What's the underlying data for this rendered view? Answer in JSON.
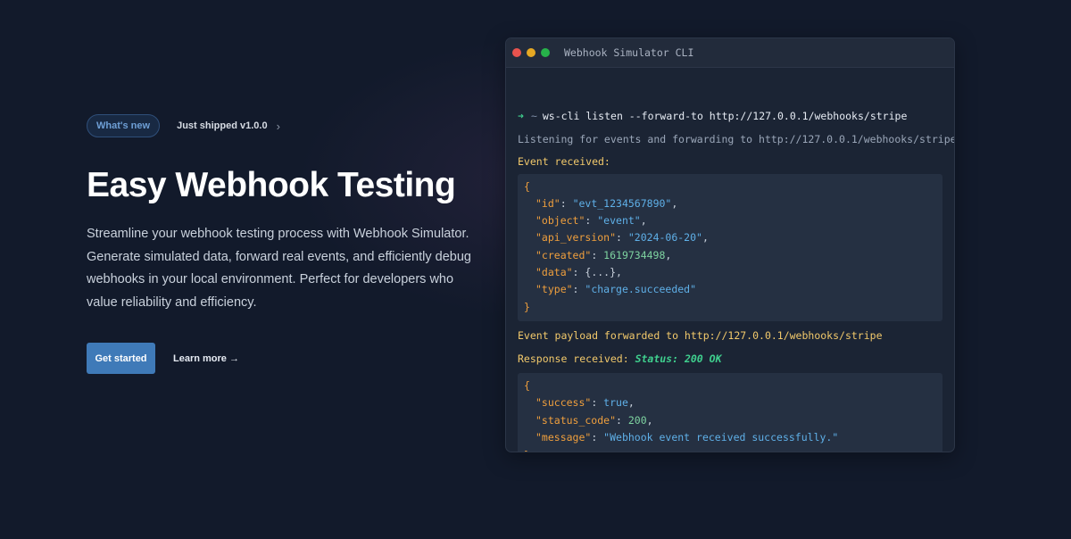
{
  "hero": {
    "badge": "What's new",
    "shipped": "Just shipped v1.0.0",
    "title": "Easy Webhook Testing",
    "description": "Streamline your webhook testing process with Webhook Simulator. Generate simulated data, forward real events, and efficiently debug webhooks in your local environment. Perfect for developers who value reliability and efficiency.",
    "cta_primary": "Get started",
    "cta_secondary": "Learn more →"
  },
  "terminal": {
    "title": "Webhook Simulator CLI",
    "prompt_symbol": "➜",
    "prompt_dir": "~",
    "command": "ws-cli listen --forward-to http://127.0.0.1/webhooks/stripe",
    "listening": "Listening for events and forwarding to http://127.0.0.1/webhooks/stripe",
    "event_received": "Event received:",
    "event_json": {
      "open": "{",
      "fields": [
        {
          "key": "\"id\"",
          "value": "\"evt_1234567890\"",
          "kind": "str"
        },
        {
          "key": "\"object\"",
          "value": "\"event\"",
          "kind": "str"
        },
        {
          "key": "\"api_version\"",
          "value": "\"2024-06-20\"",
          "kind": "str"
        },
        {
          "key": "\"created\"",
          "value": "1619734498",
          "kind": "num"
        },
        {
          "key": "\"data\"",
          "value": "{...}",
          "kind": "plain"
        },
        {
          "key": "\"type\"",
          "value": "\"charge.succeeded\"",
          "kind": "str"
        }
      ],
      "close": "}"
    },
    "forwarded": "Event payload forwarded to http://127.0.0.1/webhooks/stripe",
    "response_label": "Response received:",
    "response_status": "Status: 200 OK",
    "response_json": {
      "open": "{",
      "fields": [
        {
          "key": "\"success\"",
          "value": "true",
          "kind": "bool"
        },
        {
          "key": "\"status_code\"",
          "value": "200",
          "kind": "num"
        },
        {
          "key": "\"message\"",
          "value": "\"Webhook event received successfully.\"",
          "kind": "str"
        }
      ],
      "close": "}"
    }
  },
  "colors": {
    "background": "#121a2b",
    "accent": "#3f7ab8",
    "json_key": "#ef9f3d",
    "json_string": "#5fb0e8",
    "json_number": "#7ed3a0",
    "status_ok": "#3fcf8e"
  }
}
